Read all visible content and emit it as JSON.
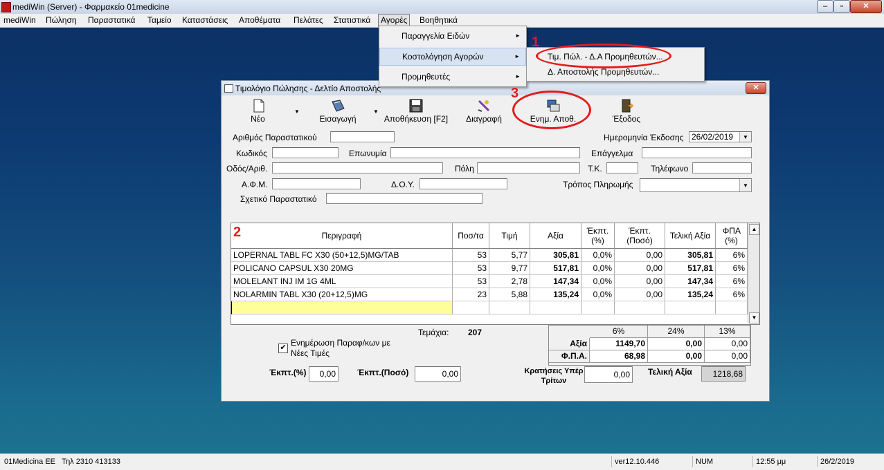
{
  "window": {
    "title": "mediWin (Server) - Φαρμακείο 01medicine"
  },
  "menubar": [
    "mediWin",
    "Πώληση",
    "Παραστατικά",
    "Ταμείο",
    "Καταστάσεις",
    "Αποθέματα",
    "Πελάτες",
    "Στατιστικά",
    "Αγορές",
    "Βοηθητικά"
  ],
  "dropdown": {
    "items": [
      {
        "label": "Παραγγελία Ειδών"
      },
      {
        "label": "Κοστολόγηση Αγορών"
      },
      {
        "label": "Προμηθευτές"
      }
    ],
    "submenu": [
      {
        "label": "Τιμ. Πώλ. - Δ.Α Προμηθευτών..."
      },
      {
        "label": "Δ. Αποστολής Προμηθευτών..."
      }
    ]
  },
  "annotations": [
    "1",
    "2",
    "3"
  ],
  "dialog": {
    "title": "Τιμολόγιο Πώλησης - Δελτίο Αποστολής",
    "toolbar": [
      "Νέο",
      "Εισαγωγή",
      "Αποθήκευση [F2]",
      "Διαγραφή",
      "Ενημ. Αποθ.",
      "Έξοδος"
    ],
    "form": {
      "doc_number_label": "Αριθμός Παραστατικού",
      "date_label": "Ημερομηνία Έκδοσης",
      "date_value": "26/02/2019",
      "code_label": "Κωδικός",
      "name_label": "Επωνυμία",
      "profession_label": "Επάγγελμα",
      "address_label": "Οδός/Αριθ.",
      "city_label": "Πόλη",
      "zip_label": "Τ.Κ.",
      "phone_label": "Τηλέφωνο",
      "afm_label": "Α.Φ.Μ.",
      "doy_label": "Δ.Ο.Υ.",
      "payment_label": "Τρόπος Πληρωμής",
      "related_label": "Σχετικό Παραστατικό"
    },
    "grid": {
      "headers": [
        "Περιγραφή",
        "Ποσ/τα",
        "Τιμή",
        "Αξία",
        "Έκπτ. (%)",
        "Έκπτ. (Ποσό)",
        "Τελική Αξία",
        "ΦΠΑ (%)"
      ],
      "rows": [
        [
          "LOPERNAL TABL FC X30 (50+12,5)MG/TAB",
          "53",
          "5,77",
          "305,81",
          "0,0%",
          "0,00",
          "305,81",
          "6%"
        ],
        [
          "POLICANO CAPSUL X30 20MG",
          "53",
          "9,77",
          "517,81",
          "0,0%",
          "0,00",
          "517,81",
          "6%"
        ],
        [
          "MOLELANT INJ IM 1G 4ML",
          "53",
          "2,78",
          "147,34",
          "0,0%",
          "0,00",
          "147,34",
          "6%"
        ],
        [
          "NOLARMIN TABL X30 (20+12,5)MG",
          "23",
          "5,88",
          "135,24",
          "0,0%",
          "0,00",
          "135,24",
          "6%"
        ]
      ]
    },
    "summary": {
      "items_label": "Τεμάχια:",
      "items_value": "207",
      "update_checkbox_label_1": "Ενημέρωση Παραφ/κων με",
      "update_checkbox_label_2": "Νέες Τιμές",
      "update_checked": true,
      "discount_pct_label": "Έκπτ.(%)",
      "discount_pct_value": "0,00",
      "discount_amt_label": "Έκπτ.(Ποσό)",
      "discount_amt_value": "0,00",
      "withholding_label_1": "Κρατήσεις Υπέρ",
      "withholding_label_2": "Τρίτων",
      "withholding_value": "0,00",
      "final_label": "Τελική Αξία",
      "final_value": "1218,68",
      "vat_headers": [
        "6%",
        "24%",
        "13%"
      ],
      "vat_rows": [
        {
          "label": "Αξία",
          "values": [
            "1149,70",
            "0,00",
            "0,00"
          ]
        },
        {
          "label": "Φ.Π.Α.",
          "values": [
            "68,98",
            "0,00",
            "0,00"
          ]
        }
      ]
    }
  },
  "statusbar": [
    "01Medicina EE   Τηλ 2310 413133",
    "ver12.10.446",
    "NUM",
    "12:55 μμ",
    "26/2/2019"
  ]
}
